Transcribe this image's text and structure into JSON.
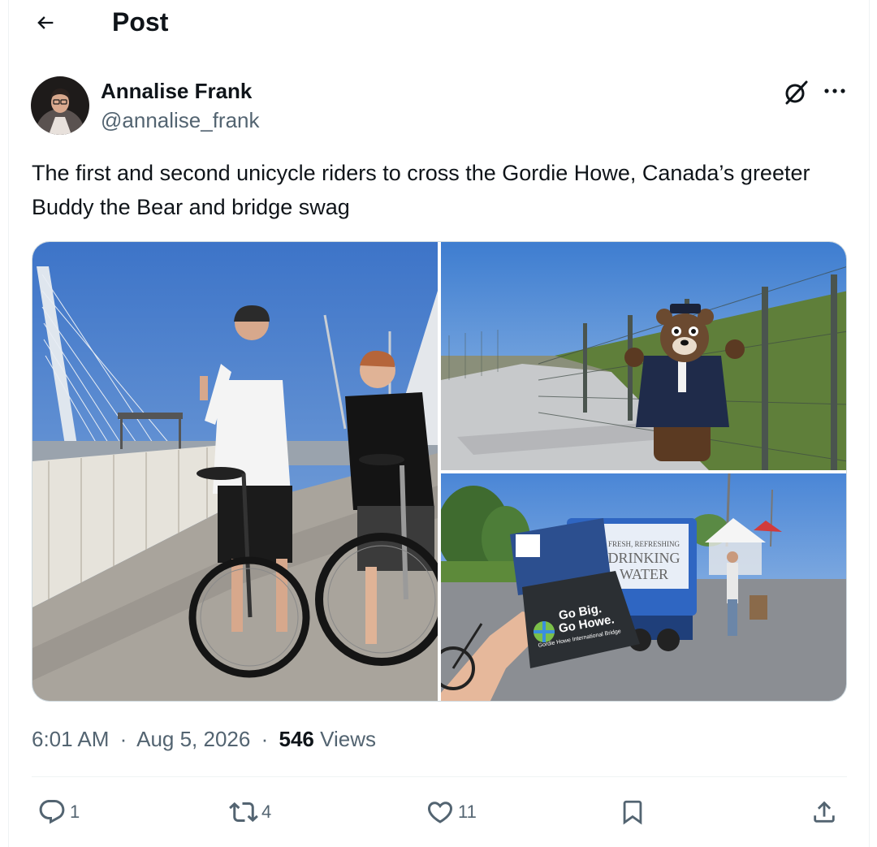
{
  "header": {
    "title": "Post",
    "back_icon": "arrow-left-icon"
  },
  "author": {
    "name": "Annalise Frank",
    "handle": "@annalise_frank"
  },
  "tweet": {
    "text": "The first and second unicycle riders to cross the Gordie Howe, Canada’s greeter Buddy the Bear and bridge swag"
  },
  "media": {
    "images": [
      {
        "subject": "two unicycle riders on bridge"
      },
      {
        "subject": "bear mascot by fence"
      },
      {
        "subject": "Go Big. Go Howe. bag and water truck",
        "truck_text_1": "FRESH, REFRESHING",
        "truck_text_2": "DRINKING",
        "truck_text_3": "WATER",
        "bag_text_1": "Go Big.",
        "bag_text_2": "Go Howe.",
        "bag_text_3": "Gordie Howe International Bridge"
      }
    ]
  },
  "meta": {
    "time": "6:01 AM",
    "sep": "·",
    "date": "Aug 5, 2026",
    "views_count": "546",
    "views_label": "Views"
  },
  "actions": {
    "replies": "1",
    "reposts": "4",
    "likes": "11"
  },
  "colors": {
    "text": "#0f1419",
    "secondary": "#536471",
    "border": "#cfd9de"
  }
}
